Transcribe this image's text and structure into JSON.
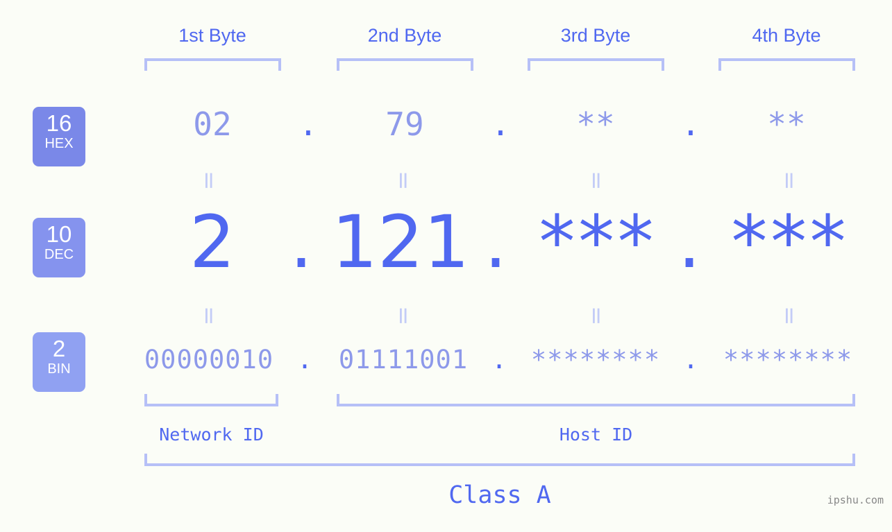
{
  "meta": {
    "background": "#fbfdf7",
    "accent_dark": "#5068f0",
    "accent_mid": "#8d99ea",
    "accent_light": "#b6c0f7",
    "connector": "#c3ccf7",
    "watermark": "ipshu.com"
  },
  "byte_headers": [
    {
      "label": "1st Byte"
    },
    {
      "label": "2nd Byte"
    },
    {
      "label": "3rd Byte"
    },
    {
      "label": "4th Byte"
    }
  ],
  "bases": [
    {
      "number": "16",
      "name": "HEX",
      "color": "#7a88e8"
    },
    {
      "number": "10",
      "name": "DEC",
      "color": "#8593ee"
    },
    {
      "number": "2",
      "name": "BIN",
      "color": "#90a1f2"
    }
  ],
  "rows": {
    "hex": {
      "values": [
        "02",
        "79",
        "**",
        "**"
      ],
      "separator": "."
    },
    "dec": {
      "values": [
        "2",
        "121",
        "***",
        "***"
      ],
      "separator": "."
    },
    "bin": {
      "values": [
        "00000010",
        "01111001",
        "********",
        "********"
      ],
      "separator": "."
    }
  },
  "connector_symbol": "=",
  "segments": {
    "network_id": "Network ID",
    "host_id": "Host ID"
  },
  "class": {
    "label": "Class A"
  }
}
